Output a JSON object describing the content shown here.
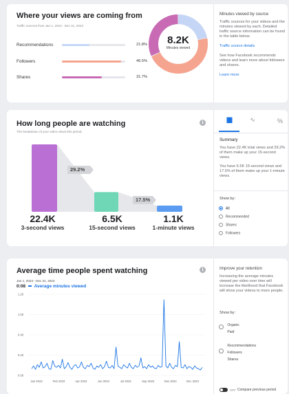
{
  "sources": {
    "title": "Where your views are coming from",
    "subtitle": "Traffic sources from Jan 1, 2023 - Dec 31, 2023",
    "rows": [
      {
        "label": "Recommendations",
        "pct": "21.8%",
        "value": 21.8,
        "color": "#c5d5f5"
      },
      {
        "label": "Followers",
        "pct": "46.5%",
        "value": 46.5,
        "color": "#f5a48f"
      },
      {
        "label": "Shares",
        "pct": "31.7%",
        "value": 31.7,
        "color": "#c86bb4"
      }
    ],
    "donut_value": "8.2K",
    "donut_label": "Minutes viewed",
    "side": {
      "heading": "Minutes viewed by source",
      "text": "Traffic sources for your videos and the minutes viewed by each. Detailed traffic source information can be found in the table below.",
      "link1": "Traffic source details",
      "text2": "See how Facebook recommends videos and learn more about followers and shares.",
      "link2": "Learn more"
    }
  },
  "watching": {
    "title": "How long people are watching",
    "subtitle": "The breakdown of your video views this period.",
    "info": "i",
    "stats": [
      {
        "value": "22.4K",
        "label": "3-second views"
      },
      {
        "value": "6.5K",
        "label": "15-second views"
      },
      {
        "value": "1.1K",
        "label": "1-minute views"
      }
    ],
    "pct1": "29.2%",
    "pct2": "17.5%",
    "funnel_levels": [
      1.0,
      0.292,
      0.051
    ],
    "tabs": {
      "bar": "▐█▌",
      "line": "∿",
      "percent": "%"
    },
    "side": {
      "heading": "Summary",
      "text1": "You have 22.4K total views and 29.2% of them make up your 15-second views.",
      "text2": "You have 6.5K 15-second views and 17.5% of them make up your 1-minute views.",
      "show_by": "Show by:",
      "options": [
        "All",
        "Recommended",
        "Shares",
        "Followers"
      ]
    }
  },
  "avgtime": {
    "title": "Average time people spent watching",
    "info": "i",
    "date_range": "Jan 1, 2023 - Dec 31, 2023",
    "current": "0:08",
    "legend": "Average minutes viewed",
    "line_color": "#1b74e4",
    "y_ticks": [
      "1.20",
      "1.00",
      "0.40",
      "0.20",
      "0.00"
    ],
    "x_ticks": [
      "Jan 2023",
      "Feb 2023",
      "Apr 2023",
      "Jun 2023",
      "Jul 2023",
      "Sep 2023",
      "Nov 2023",
      "Dec 2023"
    ],
    "side": {
      "heading": "Improve your retention",
      "text": "Increasing the average minutes viewed per video over time will increase the likelihood that Facebook will show your videos to more people.",
      "show_by": "Show by:",
      "group1": [
        "Organic",
        "Paid"
      ],
      "group2": [
        "Recommendations",
        "Followers",
        "Shares"
      ],
      "toggle_label": "OFF",
      "compare_label": "Compare previous period"
    }
  },
  "chart_data": {
    "type": "line",
    "series": [
      {
        "name": "Average minutes viewed",
        "values": [
          0.1,
          0.14,
          0.09,
          0.16,
          0.12,
          0.2,
          0.11,
          0.13,
          0.18,
          0.1,
          0.09,
          0.22,
          0.14,
          0.12,
          0.15,
          0.11,
          0.24,
          0.1,
          0.13,
          0.19,
          0.12,
          0.09,
          0.14,
          0.16,
          0.11,
          0.13,
          0.2,
          0.12,
          0.1,
          0.15,
          0.13,
          0.18,
          0.11,
          0.09,
          0.14,
          0.12,
          0.16,
          0.1,
          0.13,
          0.21,
          0.12,
          0.11,
          0.15,
          0.1,
          0.42,
          0.14,
          0.12,
          0.1,
          0.16,
          0.13,
          0.11,
          0.18,
          0.12,
          0.1,
          0.15,
          0.12,
          0.14,
          0.26,
          0.11,
          0.13,
          0.1,
          0.16,
          0.12,
          0.14,
          0.11,
          0.1,
          0.15,
          0.12,
          0.13,
          1.12,
          0.14,
          0.11,
          0.18,
          0.12,
          0.1,
          0.15,
          0.13,
          0.5,
          0.12,
          0.11,
          0.16,
          0.1,
          0.13,
          0.12,
          0.09,
          0.14,
          0.11,
          0.1,
          0.08,
          0.12
        ]
      }
    ],
    "x_range": [
      "Jan 2023",
      "Dec 2023"
    ],
    "ylim": [
      0,
      1.2
    ]
  }
}
